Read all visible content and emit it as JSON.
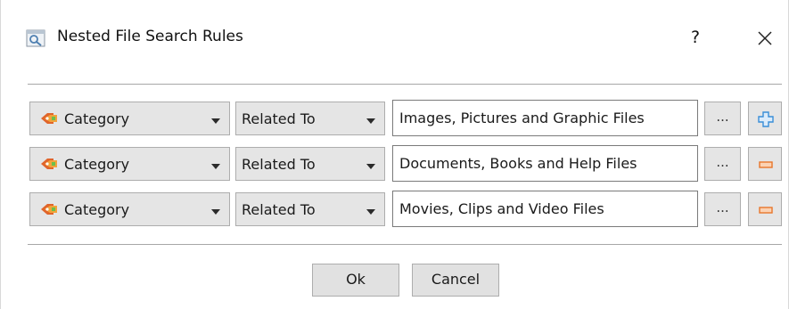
{
  "window": {
    "title": "Nested File Search Rules",
    "help_label": "?",
    "icons": {
      "app": "search-window-icon",
      "close": "close-icon"
    }
  },
  "rules": [
    {
      "field": "Category",
      "field_icon": "category-icon",
      "operator": "Related To",
      "value": "Images, Pictures and Graphic Files",
      "browse_label": "...",
      "action": "add",
      "action_icon": "plus-icon"
    },
    {
      "field": "Category",
      "field_icon": "category-icon",
      "operator": "Related To",
      "value": "Documents, Books and Help Files",
      "browse_label": "...",
      "action": "remove",
      "action_icon": "minus-icon"
    },
    {
      "field": "Category",
      "field_icon": "category-icon",
      "operator": "Related To",
      "value": "Movies, Clips and Video Files",
      "browse_label": "...",
      "action": "remove",
      "action_icon": "minus-icon"
    }
  ],
  "buttons": {
    "ok": "Ok",
    "cancel": "Cancel"
  },
  "colors": {
    "plus_accent": "#3a8fd8",
    "minus_accent": "#e8762b",
    "button_face": "#e5e5e5",
    "border": "#adadad"
  }
}
